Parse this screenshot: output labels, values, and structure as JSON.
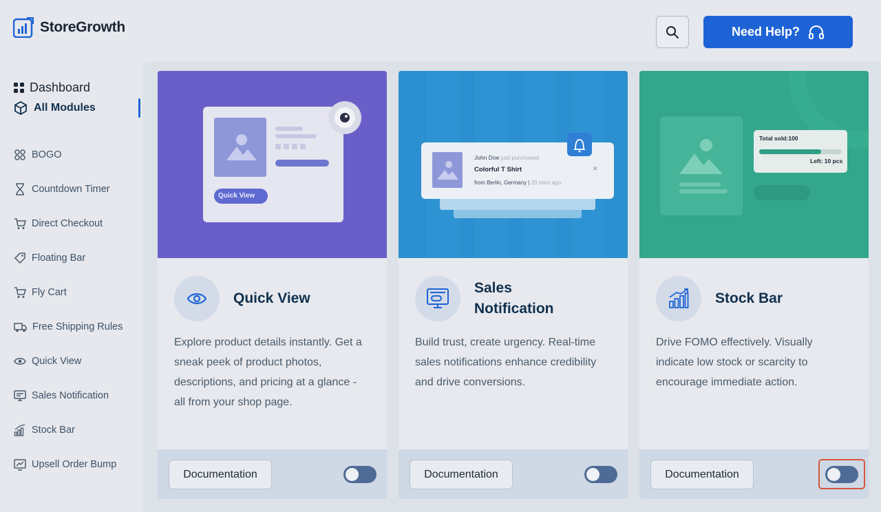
{
  "brand": {
    "name": "StoreGrowth"
  },
  "header": {
    "help_label": "Need Help?"
  },
  "sidebar": {
    "dashboard": "Dashboard",
    "all_modules": "All Modules",
    "modules": [
      {
        "label": "BOGO",
        "icon": "bogo-icon"
      },
      {
        "label": "Countdown Timer",
        "icon": "hourglass-icon"
      },
      {
        "label": "Direct Checkout",
        "icon": "cart-icon"
      },
      {
        "label": "Floating Bar",
        "icon": "tag-icon"
      },
      {
        "label": "Fly Cart",
        "icon": "fly-cart-icon"
      },
      {
        "label": "Free Shipping Rules",
        "icon": "truck-icon"
      },
      {
        "label": "Quick View",
        "icon": "eye-icon"
      },
      {
        "label": "Sales Notification",
        "icon": "monitor-icon"
      },
      {
        "label": "Stock Bar",
        "icon": "bar-chart-icon"
      },
      {
        "label": "Upsell Order Bump",
        "icon": "upsell-icon"
      }
    ]
  },
  "cards": [
    {
      "title": "Quick View",
      "description": "Explore product details instantly. Get a sneak peek of product photos, descriptions, and pricing at a glance - all from your shop page.",
      "doc_label": "Documentation",
      "enabled": false,
      "hero": {
        "button": "Quick View"
      }
    },
    {
      "title": "Sales Notification",
      "description": "Build trust, create urgency. Real-time sales notifications enhance credibility and drive conversions.",
      "doc_label": "Documentation",
      "enabled": false,
      "hero": {
        "buyer": "John Doe",
        "action": "just purchased",
        "product": "Colorful T Shirt",
        "location": "from Berlin, Germany",
        "time": "20 mins ago",
        "close": "×"
      }
    },
    {
      "title": "Stock Bar",
      "description": "Drive FOMO effectively. Visually indicate low stock or scarcity to encourage immediate action.",
      "doc_label": "Documentation",
      "enabled": false,
      "hero": {
        "sold_label": "Total sold:100",
        "left_label": "Left: 10 pcs",
        "sold_fraction": 0.75
      }
    }
  ],
  "colors": {
    "accent": "#1e63d6",
    "card1_hero": "#6a5fc9",
    "card2_hero": "#2c8fcf",
    "card3_hero": "#33a68b",
    "focus": "#d2573b"
  }
}
